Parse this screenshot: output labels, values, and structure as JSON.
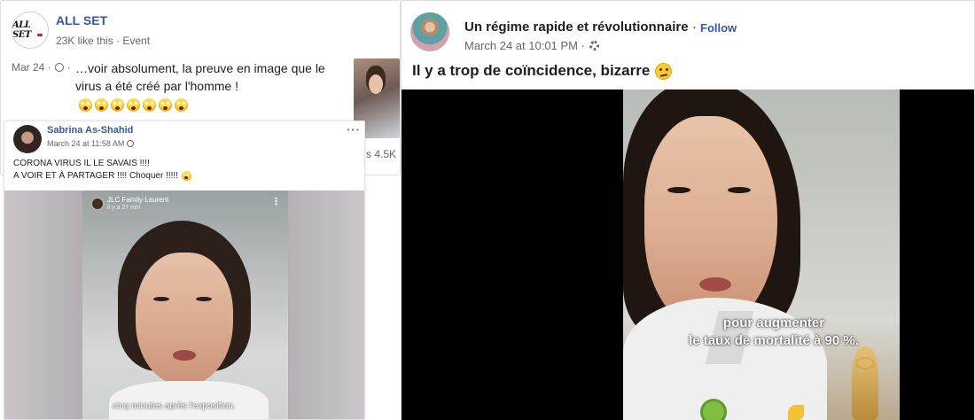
{
  "left_post_back": {
    "page_name": "ALL SET",
    "meta": "23K like this · Event",
    "date": "Mar 24 ·",
    "text_line1": "…voir absolument, la preuve en image que le",
    "text_line2": "virus a été créé par l'homme !",
    "emoji_icon": "face-screaming-in-fear-emoji",
    "emoji_count": 7,
    "share_count": "s 4.5K"
  },
  "left_post_front": {
    "author": "Sabrina As-Shahid",
    "timestamp": "March 24 at 11:58 AM",
    "more": "···",
    "text_line1": "CORONA VIRUS IL LE SAVAIS !!!!",
    "text_line2": "A VOIR ET À PARTAGER !!!! Choquer !!!!!",
    "video": {
      "overlay_name": "JLC Family Laurent",
      "overlay_time": "il y a 27 min",
      "caption": "cinq minutes après l'exposition."
    }
  },
  "right_post": {
    "page_name": "Un régime rapide et révolutionnaire",
    "separator": "·",
    "follow_label": "Follow",
    "timestamp": "March 24 at 10:01 PM ·",
    "text": "Il y a trop de coïncidence, bizarre",
    "emoji_icon": "thinking-face-emoji",
    "video": {
      "caption_line1": "pour augmenter",
      "caption_line2": "le taux de mortalité à 90 %."
    }
  },
  "colors": {
    "link_blue": "#385898",
    "meta_gray": "#606770",
    "text": "#1c1e21"
  }
}
